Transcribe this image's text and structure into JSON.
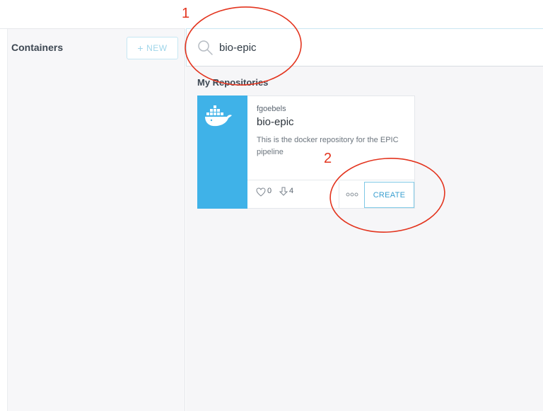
{
  "sidebar": {
    "title": "Containers",
    "new_button_plus": "+",
    "new_button_label": "NEW"
  },
  "search": {
    "value": "bio-epic",
    "placeholder": ""
  },
  "results": {
    "section_title": "My Repositories",
    "repositories": [
      {
        "owner": "fgoebels",
        "name": "bio-epic",
        "description": "This is the docker repository for the EPIC pipeline",
        "favorites": "0",
        "pulls": "4",
        "more_label": "ooo",
        "create_label": "CREATE"
      }
    ]
  },
  "annotations": {
    "label_1": "1",
    "label_2": "2"
  },
  "colors": {
    "accent": "#3fb2e8",
    "annotation": "#e3341e"
  },
  "icons": [
    "search-icon",
    "docker-whale-icon",
    "heart-icon",
    "download-icon",
    "more-dots-icon"
  ]
}
